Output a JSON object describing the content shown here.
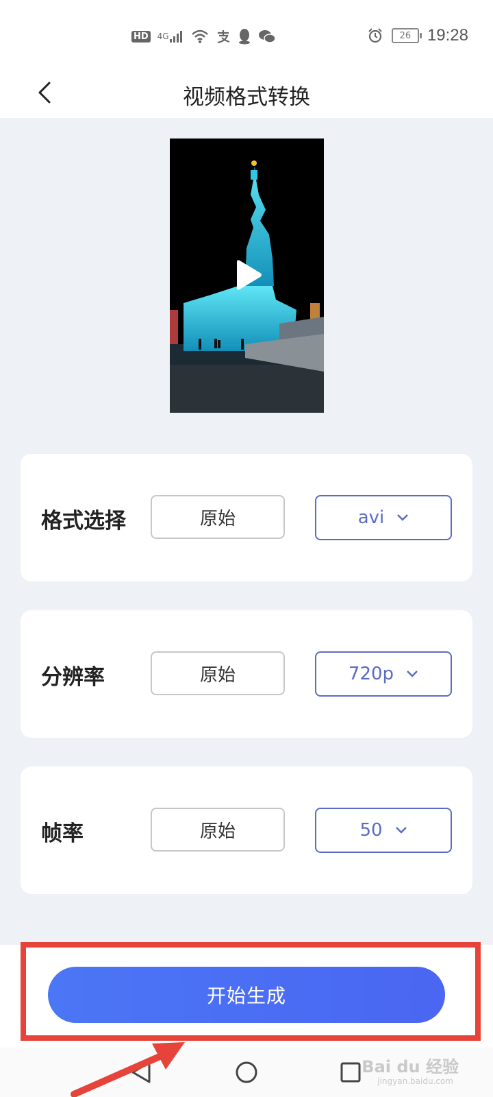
{
  "status_bar": {
    "left_icons": [
      "hd-icon",
      "signal-4g-icon",
      "wifi-icon",
      "alipay-icon",
      "qq-icon",
      "wechat-icon"
    ],
    "hd_label": "HD",
    "network_label": "4G",
    "battery_level": "26",
    "time": "19:28"
  },
  "header": {
    "title": "视频格式转换",
    "back_icon": "chevron-left-icon"
  },
  "video": {
    "play_icon": "play-icon"
  },
  "settings": [
    {
      "label": "格式选择",
      "original": "原始",
      "selected": "avi"
    },
    {
      "label": "分辨率",
      "original": "原始",
      "selected": "720p"
    },
    {
      "label": "帧率",
      "original": "原始",
      "selected": "50"
    }
  ],
  "action": {
    "start_label": "开始生成",
    "highlight_color": "#e6443a",
    "button_color": "#4b6ef4"
  },
  "watermark": {
    "text": "Bai du 经验",
    "sub": "jingyan.baidu.com"
  }
}
